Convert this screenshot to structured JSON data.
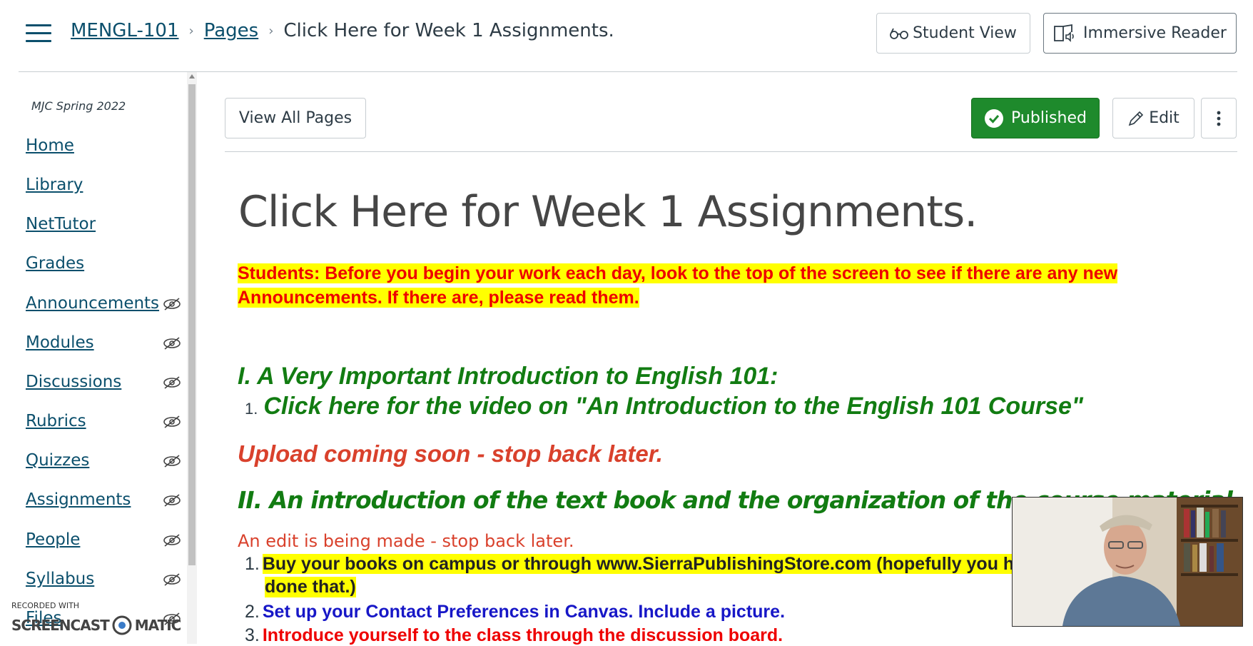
{
  "header": {
    "breadcrumb": {
      "course": "MENGL-101",
      "section": "Pages",
      "current": "Click Here for Week 1 Assignments."
    },
    "student_view_label": "Student View",
    "immersive_reader_label": "Immersive Reader"
  },
  "sidebar": {
    "term": "MJC Spring 2022",
    "items": [
      {
        "label": "Home",
        "hidden_icon": false
      },
      {
        "label": "Library",
        "hidden_icon": false
      },
      {
        "label": "NetTutor",
        "hidden_icon": false
      },
      {
        "label": "Grades",
        "hidden_icon": false
      },
      {
        "label": "Announcements",
        "hidden_icon": true
      },
      {
        "label": "Modules",
        "hidden_icon": true
      },
      {
        "label": "Discussions",
        "hidden_icon": true
      },
      {
        "label": "Rubrics",
        "hidden_icon": true
      },
      {
        "label": "Quizzes",
        "hidden_icon": true
      },
      {
        "label": "Assignments",
        "hidden_icon": true
      },
      {
        "label": "People",
        "hidden_icon": true
      },
      {
        "label": "Syllabus",
        "hidden_icon": true
      },
      {
        "label": "Files",
        "hidden_icon": true
      }
    ]
  },
  "toolbar": {
    "view_all_pages_label": "View All Pages",
    "published_label": "Published",
    "edit_label": "Edit",
    "more_icon": "kebab-icon"
  },
  "page": {
    "title": "Click Here for Week 1 Assignments.",
    "notice": "Students: Before you begin your work each day, look to the top of the screen to see if there are any new Announcements. If there are, please read them.",
    "section1_heading": "I. A Very Important Introduction to English 101:",
    "section1_items": [
      "Click here for the video on \"An Introduction to the English 101 Course\""
    ],
    "upload_note": "Upload coming soon - stop back later.",
    "section2_heading": "II. An introduction of the text book and the organization of the course material.",
    "edit_note": "An edit is being made - stop back later.",
    "section2_items": [
      {
        "num": "1.",
        "text": "Buy your books on campus or through www.SierraPublishingStore.com (hopefully you have",
        "cont": "done that.)"
      },
      {
        "num": "2.",
        "text": "Set up your Contact Preferences in Canvas. Include a picture."
      },
      {
        "num": "3.",
        "text": "Introduce yourself to the class through the discussion board."
      }
    ]
  },
  "watermark": {
    "line1": "RECORDED WITH",
    "line2a": "SCREENCAST",
    "line2b": "MATIC"
  },
  "colors": {
    "link": "#0b4f6c",
    "published_green": "#1e8a2c",
    "notice_red": "#ee0000",
    "highlight_yellow": "#ffff00",
    "heading_green": "#127c12",
    "note_red": "#d9412c",
    "item_blue": "#1717c7"
  }
}
